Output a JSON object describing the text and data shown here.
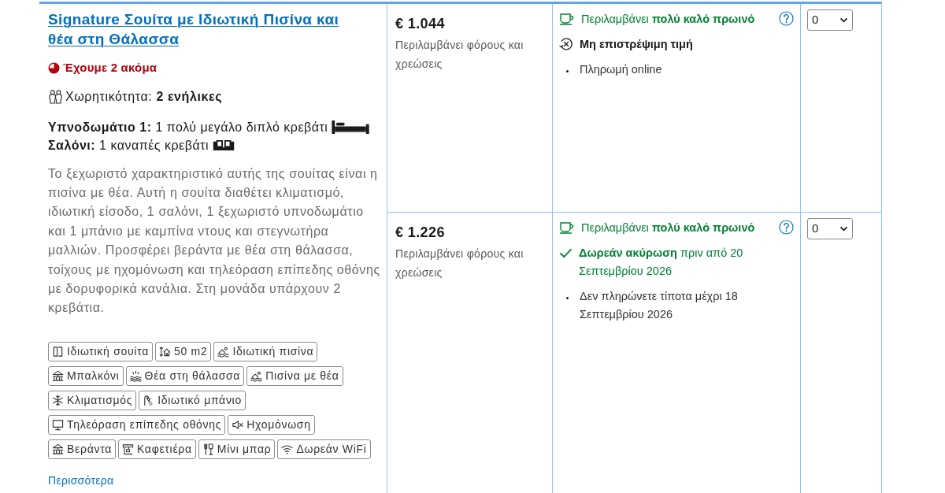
{
  "room": {
    "name": "Signature Σουίτα με Ιδιωτική Πισίνα και θέα στη Θάλασσα",
    "availability": "Έχουμε 2 ακόμα",
    "occupancy": "Χωρητικότητα: **2 ενήλικες**",
    "beds": [
      {
        "kind": "double-bed",
        "text": "**Υπνοδωμάτιο 1:** 1 πολύ μεγάλο διπλό κρεβάτι"
      },
      {
        "kind": "sofa-bed",
        "text": "**Σαλόνι:** 1 καναπές κρεβάτι"
      }
    ],
    "description": "Το ξεχωριστό χαρακτηριστικό αυτής της σουίτας είναι η πισίνα με θέα. Αυτή η σουίτα διαθέτει κλιματισμό, ιδιωτική είσοδο, 1 σαλόνι, 1 ξεχωριστό υπνοδωμάτιο και 1 μπάνιο με καμπίνα ντους και στεγνωτήρα μαλλιών. Προσφέρει βεράντα με θέα στη θάλασσα, τοίχους με ηχομόνωση και τηλεόραση επίπεδης οθόνης με δορυφορικά κανάλια. Στη μονάδα υπάρχουν 2 κρεβάτια.",
    "facilities": [
      {
        "kind": "suite",
        "label": "Ιδιωτική σουίτα"
      },
      {
        "kind": "size",
        "label": "50 m2"
      },
      {
        "kind": "pool",
        "label": "Ιδιωτική πισίνα"
      },
      {
        "kind": "balcony",
        "label": "Μπαλκόνι"
      },
      {
        "kind": "sea-view",
        "label": "Θέα στη θάλασσα"
      },
      {
        "kind": "pool-view",
        "label": "Πισίνα με θέα"
      },
      {
        "kind": "air-conditioning",
        "label": "Κλιματισμός"
      },
      {
        "kind": "bathroom",
        "label": "Ιδιωτικό μπάνιο"
      },
      {
        "kind": "tv",
        "label": "Τηλεόραση επίπεδης οθόνης"
      },
      {
        "kind": "soundproofing",
        "label": "Ηχομόνωση"
      },
      {
        "kind": "terrace",
        "label": "Βεράντα"
      },
      {
        "kind": "coffee-machine",
        "label": "Καφετιέρα"
      },
      {
        "kind": "minibar",
        "label": "Μίνι μπαρ"
      },
      {
        "kind": "wifi",
        "label": "Δωρεάν WiFi"
      }
    ],
    "more_link": "Περισσότερα"
  },
  "rates": [
    {
      "price": "€ 1.044",
      "price_note": "Περιλαμβάνει φόρους και χρεώσεις",
      "conditions": [
        {
          "kind": "meal",
          "text": "Περιλαμβάνει **πολύ καλό πρωινό**",
          "help_icon": true
        },
        {
          "kind": "non-refundable",
          "text": "Μη επιστρέψιμη τιμή"
        },
        {
          "kind": "bullet",
          "text": "Πληρωμή online"
        }
      ],
      "quantity": "0"
    },
    {
      "price": "€ 1.226",
      "price_note": "Περιλαμβάνει φόρους και χρεώσεις",
      "conditions": [
        {
          "kind": "meal",
          "text": "Περιλαμβάνει **πολύ καλό πρωινό**",
          "help_icon": true
        },
        {
          "kind": "free-cancellation",
          "text": "**Δωρεάν ακύρωση** πριν από 20 Σεπτεμβρίου 2026"
        },
        {
          "kind": "bullet",
          "text": "Δεν πληρώνετε τίποτα μέχρι 18 Σεπτεμβρίου 2026"
        }
      ],
      "quantity": "0"
    }
  ]
}
